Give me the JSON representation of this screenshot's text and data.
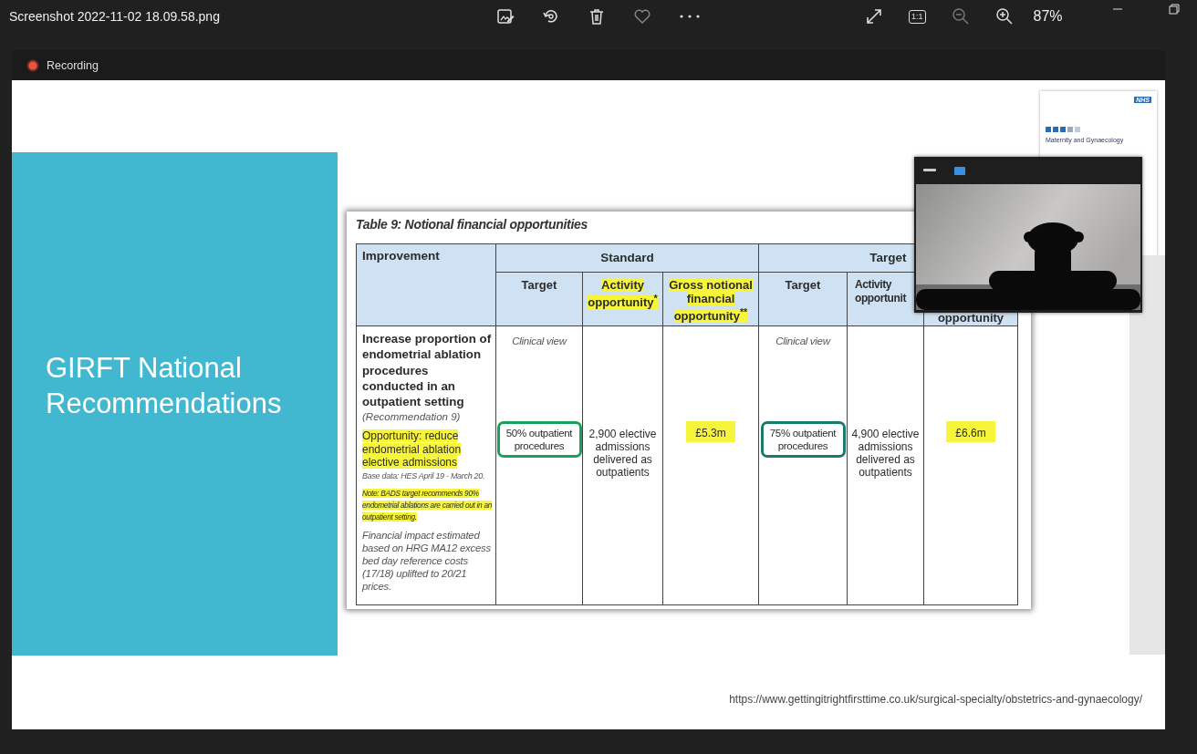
{
  "viewer": {
    "title": "Screenshot 2022-11-02 18.09.58.png",
    "actual_size": "1:1",
    "zoom": "87%"
  },
  "recording": {
    "label": "Recording"
  },
  "slide": {
    "title": "GIRFT National Recommendations",
    "report": {
      "badge": "NHS",
      "title": "Maternity and Gynaecology"
    },
    "table": {
      "caption": "Table 9: Notional financial opportunities",
      "corner": "Improvement",
      "improvement": [
        {
          "kind": "title",
          "text": "Increase proportion of endometrial ablation procedures conducted in an outpatient setting",
          "highlighted": false
        },
        {
          "kind": "reference",
          "text": "(Recommendation 9)",
          "highlighted": false
        },
        {
          "kind": "opportunity",
          "text": "Opportunity: reduce endometrial ablation elective admissions",
          "highlighted": true
        },
        {
          "kind": "base",
          "text": "Base data: HES April 19 - March 20.",
          "highlighted": false
        },
        {
          "kind": "note",
          "text": "Note: BADS target recommends 90% endometrial ablations are carried out in an outpatient setting.",
          "highlighted": true
        },
        {
          "kind": "explanation",
          "text": "Financial impact estimated based on HRG MA12 excess bed day  reference costs (17/18) uplifted to 20/21 prices.",
          "highlighted": false
        }
      ],
      "groups": [
        {
          "label": "Standard",
          "columns": [
            {
              "label": "Target",
              "highlighted": false
            },
            {
              "label": "Activity opportunity$^{*}$",
              "highlighted": true
            },
            {
              "label": "Gross notional financial opportunity$^{**}$",
              "highlighted": true
            }
          ],
          "view": "Clinical view",
          "target": {
            "text": "50% outpatient procedures",
            "color": "#1aa05a"
          },
          "activity": "2,900 elective admissions delivered as outpatients",
          "financial": {
            "text": "£5.3m",
            "highlighted": true
          }
        },
        {
          "label": "Target",
          "columns": [
            {
              "label": "Target",
              "highlighted": false
            },
            {
              "label": "Activity opportunit",
              "highlighted": false
            },
            {
              "label": "opportunity",
              "highlighted": false
            }
          ],
          "view": "Clinical view",
          "target": {
            "text": "75% outpatient procedures",
            "color": "#1b7a6c"
          },
          "activity": "4,900 elective admissions delivered as outpatients",
          "financial": {
            "text": "£6.6m",
            "highlighted": true
          }
        }
      ]
    },
    "url": "https://www.gettingitrightfirsttime.co.uk/surgical-specialty/obstetrics-and-gynaecology/"
  }
}
